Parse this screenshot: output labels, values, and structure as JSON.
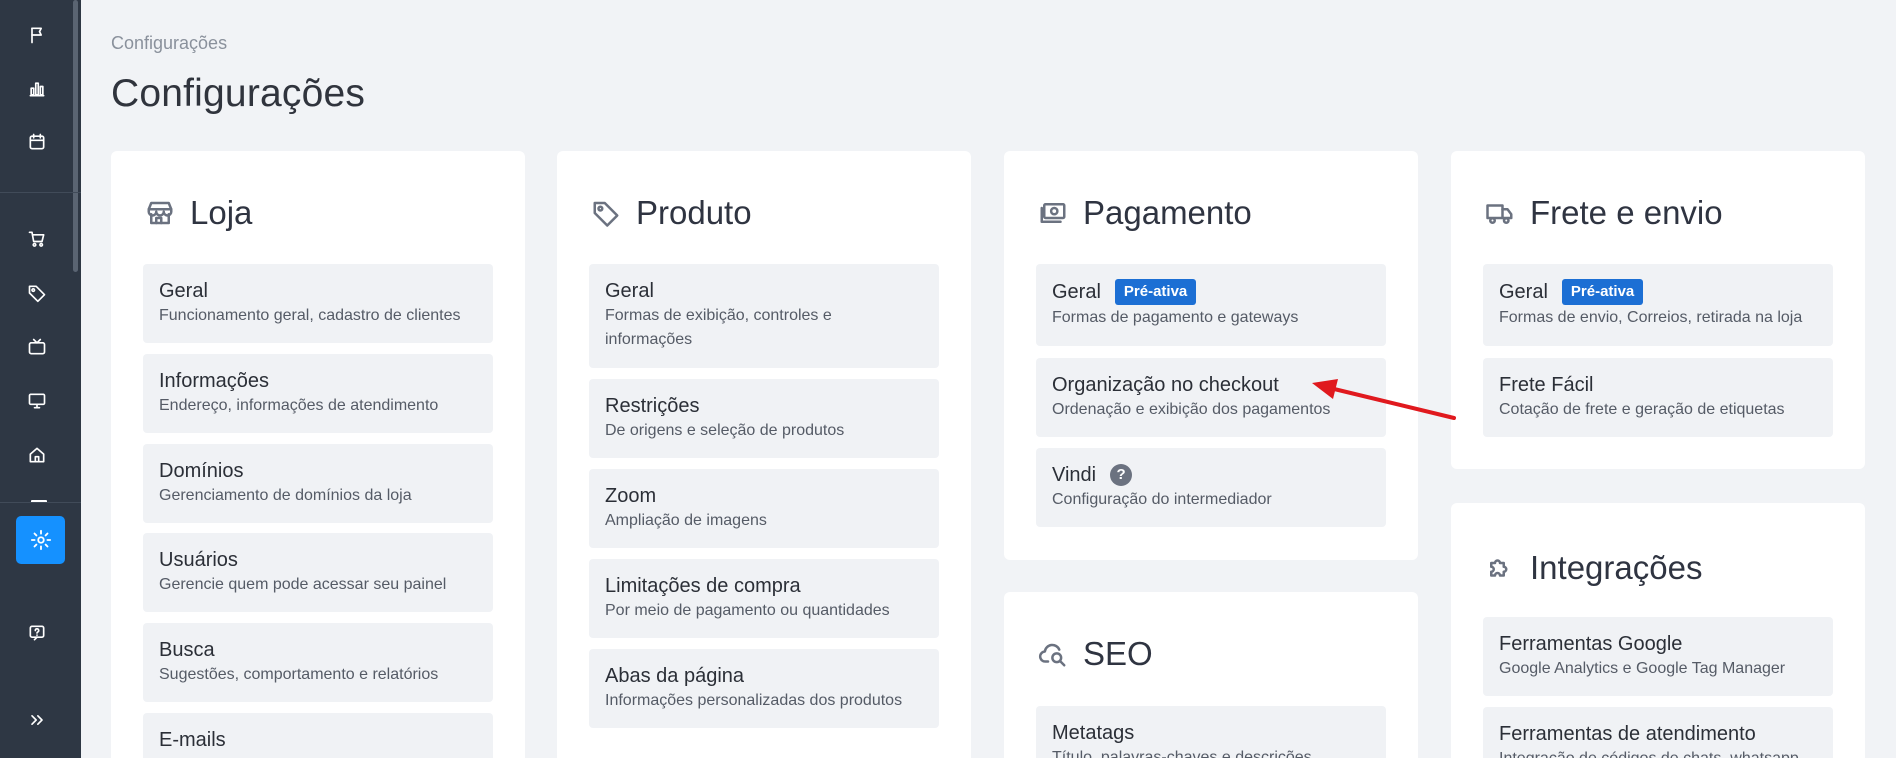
{
  "breadcrumb": "Configurações",
  "page_title": "Configurações",
  "colors": {
    "accent": "#1591ff",
    "badge": "#1c6fd4",
    "annotation_arrow": "#e0191e",
    "sidebar": "#2e3744"
  },
  "sidebar": {
    "icons": [
      "flag-icon",
      "bar-chart-icon",
      "calendar-icon",
      "cart-icon",
      "tag-icon",
      "tv-icon",
      "monitor-icon",
      "home-icon",
      "gear-icon",
      "help-chat-icon",
      "expand-icon"
    ]
  },
  "loja": {
    "title": "Loja",
    "items": [
      {
        "title": "Geral",
        "desc": "Funcionamento geral, cadastro de clientes"
      },
      {
        "title": "Informações",
        "desc": "Endereço, informações de atendimento"
      },
      {
        "title": "Domínios",
        "desc": "Gerenciamento de domínios da loja"
      },
      {
        "title": "Usuários",
        "desc": "Gerencie quem pode acessar seu painel"
      },
      {
        "title": "Busca",
        "desc": "Sugestões, comportamento e relatórios"
      },
      {
        "title": "E-mails",
        "desc": ""
      }
    ]
  },
  "produto": {
    "title": "Produto",
    "items": [
      {
        "title": "Geral",
        "desc": "Formas de exibição, controles e informações"
      },
      {
        "title": "Restrições",
        "desc": "De origens e seleção de produtos"
      },
      {
        "title": "Zoom",
        "desc": "Ampliação de imagens"
      },
      {
        "title": "Limitações de compra",
        "desc": "Por meio de pagamento ou quantidades"
      },
      {
        "title": "Abas da página",
        "desc": "Informações personalizadas dos produtos"
      }
    ]
  },
  "pagamento": {
    "title": "Pagamento",
    "items": [
      {
        "title": "Geral",
        "badge": "Pré-ativa",
        "desc": "Formas de pagamento e gateways"
      },
      {
        "title": "Organização no checkout",
        "desc": "Ordenação e exibição dos pagamentos"
      },
      {
        "title": "Vindi",
        "help": "?",
        "desc": "Configuração do intermediador"
      }
    ]
  },
  "seo": {
    "title": "SEO",
    "items": [
      {
        "title": "Metatags",
        "desc": "Título, palavras-chaves e descrições"
      }
    ]
  },
  "frete": {
    "title": "Frete e envio",
    "items": [
      {
        "title": "Geral",
        "badge": "Pré-ativa",
        "desc": "Formas de envio, Correios, retirada na loja"
      },
      {
        "title": "Frete Fácil",
        "desc": "Cotação de frete e geração de etiquetas"
      }
    ]
  },
  "integracoes": {
    "title": "Integrações",
    "items": [
      {
        "title": "Ferramentas Google",
        "desc": "Google Analytics e Google Tag Manager"
      },
      {
        "title": "Ferramentas de atendimento",
        "desc": "Integração de códigos de chats, whatsapp"
      }
    ]
  }
}
